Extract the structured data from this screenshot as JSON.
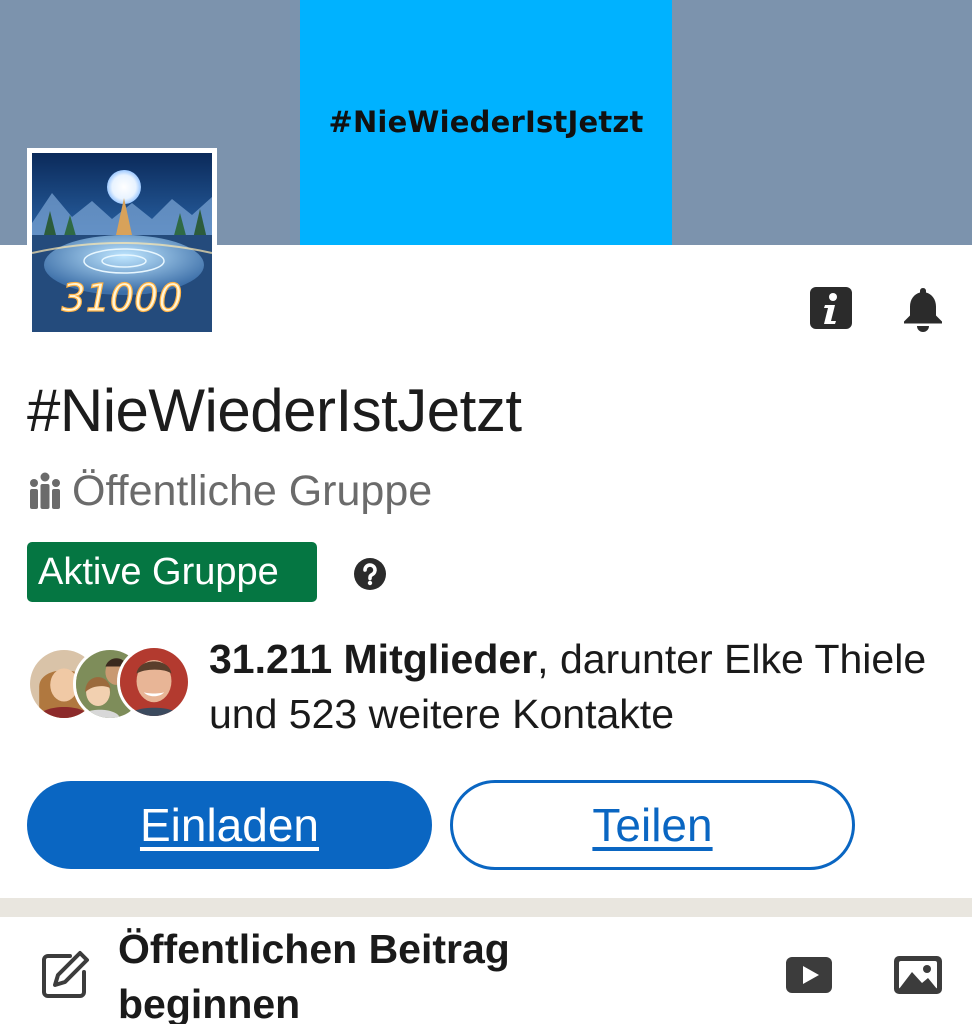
{
  "banner": {
    "text": "#NieWiederIstJetzt",
    "bg_color": "#7c93ad",
    "panel_color": "#00b2ff"
  },
  "group_avatar": {
    "number_text": "31000"
  },
  "header_icons": {
    "info": "info-icon",
    "notifications": "bell-icon"
  },
  "group": {
    "title": "#NieWiederIstJetzt",
    "privacy_icon": "people-icon",
    "privacy": "Öffentliche Gruppe",
    "badge": "Aktive Gruppe",
    "badge_color": "#057642",
    "help_icon": "question-circle-icon"
  },
  "members": {
    "count": "31.211 Mitglieder",
    "rest": ", darunter Elke Thiele und 523 weitere Kontakte"
  },
  "actions": {
    "invite": "Einladen",
    "share": "Teilen",
    "more_icon": "ellipsis-icon",
    "accent": "#0a66c2"
  },
  "composer": {
    "icon": "edit-icon",
    "label": "Öffentlichen Beitrag beginnen",
    "video_icon": "video-icon",
    "photo_icon": "image-icon"
  }
}
